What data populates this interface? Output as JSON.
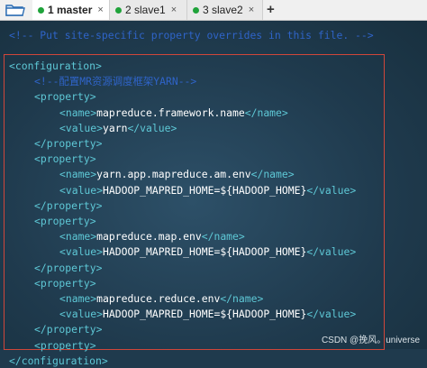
{
  "tabs": [
    {
      "label": "1 master",
      "close": "×",
      "active": true
    },
    {
      "label": "2 slave1",
      "close": "×",
      "active": false
    },
    {
      "label": "3 slave2",
      "close": "×",
      "active": false
    }
  ],
  "add_tab": "+",
  "lines": [
    {
      "indent": 10,
      "tag_open": "",
      "text": "",
      "tag_close": "",
      "raw": "<!-- Put site-specific property overrides in this file. -->",
      "kind": "comment"
    },
    {
      "indent": 10,
      "raw": "<configuration>",
      "kind": "tag"
    },
    {
      "indent": 38,
      "raw": "<!--配置MR资源调度框架YARN-->",
      "kind": "comment"
    },
    {
      "indent": 38,
      "raw": "<property>",
      "kind": "tag"
    },
    {
      "indent": 66,
      "open": "<name>",
      "text": "mapreduce.framework.name",
      "close": "</name>",
      "kind": "pair"
    },
    {
      "indent": 66,
      "open": "<value>",
      "text": "yarn",
      "close": "</value>",
      "kind": "pair"
    },
    {
      "indent": 38,
      "raw": "</property>",
      "kind": "tag"
    },
    {
      "indent": 38,
      "raw": "<property>",
      "kind": "tag"
    },
    {
      "indent": 66,
      "open": "<name>",
      "text": "yarn.app.mapreduce.am.env",
      "close": "</name>",
      "kind": "pair"
    },
    {
      "indent": 66,
      "open": "<value>",
      "text": "HADOOP_MAPRED_HOME=${HADOOP_HOME}",
      "close": "</value>",
      "kind": "pair"
    },
    {
      "indent": 38,
      "raw": "</property>",
      "kind": "tag"
    },
    {
      "indent": 38,
      "raw": "<property>",
      "kind": "tag"
    },
    {
      "indent": 66,
      "open": "<name>",
      "text": "mapreduce.map.env",
      "close": "</name>",
      "kind": "pair"
    },
    {
      "indent": 66,
      "open": "<value>",
      "text": "HADOOP_MAPRED_HOME=${HADOOP_HOME}",
      "close": "</value>",
      "kind": "pair"
    },
    {
      "indent": 38,
      "raw": "</property>",
      "kind": "tag"
    },
    {
      "indent": 38,
      "raw": "<property>",
      "kind": "tag"
    },
    {
      "indent": 66,
      "open": "<name>",
      "text": "mapreduce.reduce.env",
      "close": "</name>",
      "kind": "pair"
    },
    {
      "indent": 66,
      "open": "<value>",
      "text": "HADOOP_MAPRED_HOME=${HADOOP_HOME}",
      "close": "</value>",
      "kind": "pair"
    },
    {
      "indent": 38,
      "raw": "</property>",
      "kind": "tag"
    },
    {
      "indent": 38,
      "raw": "<property>",
      "kind": "tag"
    },
    {
      "indent": 10,
      "raw": "</configuration>",
      "kind": "tag"
    }
  ],
  "watermark": "CSDN @挽风。universe",
  "colors": {
    "background": "#1f3a4d",
    "comment": "#2f64c8",
    "tag": "#5ec8d6",
    "text": "#ffffff",
    "highlight": "#d0463a",
    "tab_dot": "#1fa33a"
  }
}
